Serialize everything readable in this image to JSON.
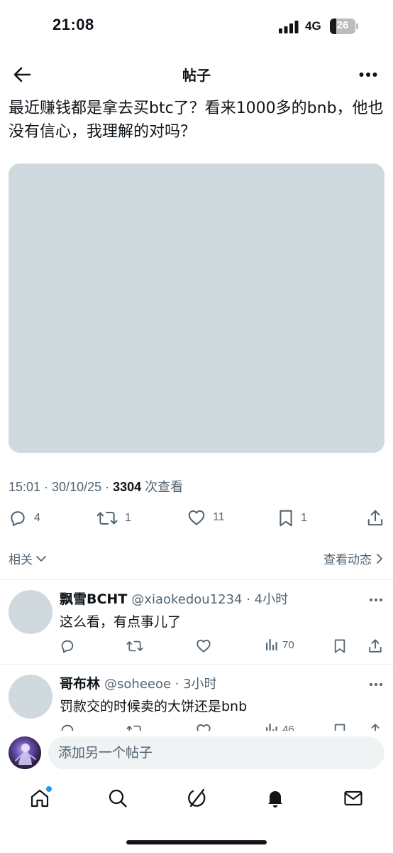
{
  "status_bar": {
    "time": "21:08",
    "network": "4G",
    "battery": "26",
    "battery_level": 0.26
  },
  "header": {
    "title": "帖子"
  },
  "post": {
    "text": "最近赚钱都是拿去买btc了？看来1000多的bnb，他也没有信心，我理解的对吗？",
    "meta_prefix": "15:01 · 30/10/25 · ",
    "views_count": "3304",
    "views_label": " 次查看",
    "actions": {
      "replies": "4",
      "reposts": "1",
      "likes": "11",
      "bookmarks": "1"
    }
  },
  "related": {
    "left_label": "相关",
    "right_label": "查看动态"
  },
  "replies": [
    {
      "name": "飘雪BCHT",
      "handle": "@xiaokedou1234 · 4小时",
      "text": "这么看，有点事儿了",
      "views": "70"
    },
    {
      "name": "哥布林",
      "handle": "@soheeoe · 3小时",
      "text": "罚款交的时候卖的大饼还是bnb",
      "views": "46"
    }
  ],
  "composer": {
    "placeholder": "添加另一个帖子"
  },
  "colors": {
    "accent": "#1d9bf0",
    "muted": "#536471",
    "media_placeholder": "#cfd9de"
  },
  "icons": {
    "header": [
      "back-arrow-icon",
      "more-horizontal-icon"
    ],
    "actions": [
      "reply-icon",
      "repost-icon",
      "like-icon",
      "bookmark-icon",
      "share-icon",
      "views-icon"
    ],
    "tabs": [
      "home-icon",
      "search-icon",
      "grok-icon",
      "notifications-icon",
      "messages-icon"
    ]
  }
}
